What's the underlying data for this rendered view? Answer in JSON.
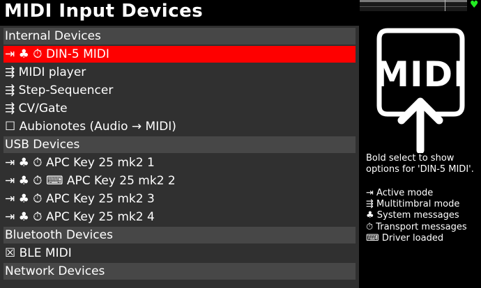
{
  "header": {
    "title": "MIDI Input Devices"
  },
  "sections": [
    {
      "label": "Internal Devices"
    },
    {
      "label": "USB Devices"
    },
    {
      "label": "Bluetooth Devices"
    },
    {
      "label": "Network Devices"
    }
  ],
  "devices": [
    {
      "text": "⇥ ♣ ⏱ DIN-5 MIDI",
      "selected": true
    },
    {
      "text": "⇶ MIDI player"
    },
    {
      "text": "⇶ Step-Sequencer"
    },
    {
      "text": "⇶ CV/Gate"
    },
    {
      "text": "☐ Aubionotes (Audio → MIDI)"
    },
    {
      "text": "⇥ ♣ ⏱ APC Key 25 mk2 1"
    },
    {
      "text": "⇥ ♣ ⏱ ⌨ APC Key 25 mk2 2"
    },
    {
      "text": "⇥ ♣ ⏱ APC Key 25 mk2 3"
    },
    {
      "text": "⇥ ♣ ⏱ APC Key 25 mk2 4"
    },
    {
      "text": "☒ BLE MIDI"
    }
  ],
  "side_panel": {
    "logo_text": "MIDI",
    "info_line1": "Bold select to show",
    "info_line2": "options for 'DIN-5 MIDI'.",
    "legend": [
      "⇥ Active mode",
      "⇶ Multitimbral mode",
      "♣ System messages",
      "⏱ Transport messages",
      "⌨ Driver loaded"
    ]
  },
  "status": {
    "heart_icon": "♥",
    "heart_color": "#22ee22",
    "selection_color": "#fe0000"
  }
}
